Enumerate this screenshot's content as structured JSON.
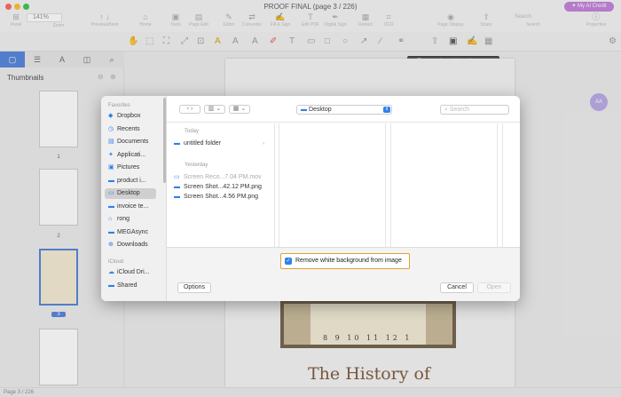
{
  "window": {
    "title": "PROOF FINAL (page 3 / 226)",
    "ai_credit": "✦ My AI Credit"
  },
  "toolbar": {
    "zoom": "141%",
    "items": [
      {
        "name": "Panel",
        "icon": "⊞"
      },
      {
        "name": "Zoom",
        "icon": "⌕"
      },
      {
        "name": "Previous/Next",
        "icon": "↑ ↓"
      },
      {
        "name": "Home",
        "icon": "⌂"
      },
      {
        "name": "Tools",
        "icon": "▣"
      },
      {
        "name": "Page Edit",
        "icon": "▤"
      },
      {
        "name": "Editor",
        "icon": "✎"
      },
      {
        "name": "Converter",
        "icon": "⇄"
      },
      {
        "name": "Fill & Sign",
        "icon": "✍"
      },
      {
        "name": "Edit PDF",
        "icon": "T"
      },
      {
        "name": "Digital Sign",
        "icon": "✒"
      },
      {
        "name": "Redact",
        "icon": "▦"
      },
      {
        "name": "OCR",
        "icon": "⌗"
      },
      {
        "name": "Page Display",
        "icon": "◉"
      },
      {
        "name": "Share",
        "icon": "⇪"
      },
      {
        "name": "Search",
        "icon": "⌕"
      },
      {
        "name": "Properties",
        "icon": "ⓘ"
      }
    ],
    "search_placeholder": "Search"
  },
  "tooltip": "Choose an image to insert in a page.",
  "sidebar": {
    "title": "Thumbnails",
    "pages": [
      "1",
      "2",
      "3"
    ]
  },
  "status": "Page 3 / 226",
  "document": {
    "clock_numbers": "8 9 10 11 12 1",
    "heading": "The History of"
  },
  "avatar": "AA",
  "dialog": {
    "favorites_label": "Favorites",
    "favorites": [
      {
        "label": "Dropbox",
        "icon": "◆"
      },
      {
        "label": "Recents",
        "icon": "◷"
      },
      {
        "label": "Documents",
        "icon": "▤"
      },
      {
        "label": "Applicati...",
        "icon": "✦"
      },
      {
        "label": "Pictures",
        "icon": "▣"
      },
      {
        "label": "product i...",
        "icon": "▬"
      },
      {
        "label": "Desktop",
        "icon": "▭"
      },
      {
        "label": "invoice te...",
        "icon": "▬"
      },
      {
        "label": "rong",
        "icon": "⌂"
      },
      {
        "label": "MEGAsync",
        "icon": "▬"
      },
      {
        "label": "Downloads",
        "icon": "⊕"
      }
    ],
    "icloud_label": "iCloud",
    "icloud": [
      {
        "label": "iCloud Dri...",
        "icon": "☁"
      },
      {
        "label": "Shared",
        "icon": "▬"
      }
    ],
    "location": "Desktop",
    "search_placeholder": "Search",
    "groups": [
      {
        "label": "Today",
        "files": [
          {
            "name": "untitled folder",
            "dim": false,
            "icon": "▬"
          }
        ]
      },
      {
        "label": "Yesterday",
        "files": [
          {
            "name": "Screen Reco...7.04 PM.mov",
            "dim": true,
            "icon": "▭"
          },
          {
            "name": "Screen Shot...42.12 PM.png",
            "dim": false,
            "icon": "▬"
          },
          {
            "name": "Screen Shot...4.56 PM.png",
            "dim": false,
            "icon": "▬"
          }
        ]
      }
    ],
    "checkbox_label": "Remove white background from image",
    "options_button": "Options",
    "cancel_button": "Cancel",
    "open_button": "Open"
  }
}
